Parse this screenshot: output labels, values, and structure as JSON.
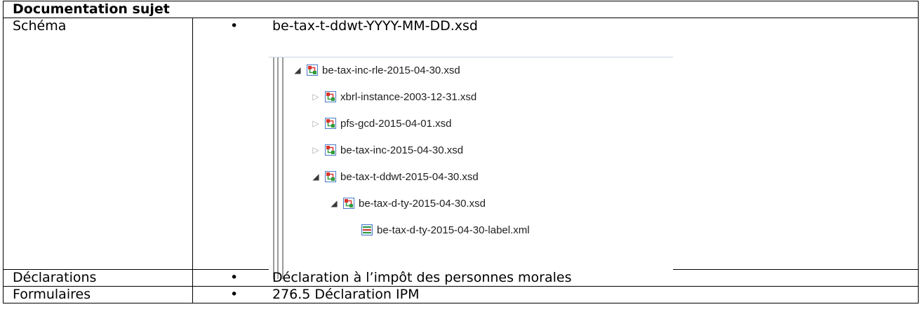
{
  "table": {
    "header": "Documentation sujet",
    "rows": [
      {
        "label": "Schéma",
        "bullets": [
          "be-tax-t-ddwt-YYYY-MM-DD.xsd"
        ]
      },
      {
        "label": "Déclarations",
        "bullets": [
          "Déclaration à l’impôt des personnes morales"
        ]
      },
      {
        "label": "Formulaires",
        "bullets": [
          "276.5 Déclaration IPM"
        ]
      }
    ]
  },
  "tree": {
    "nodes": [
      {
        "label": "be-tax-inc-rle-2015-04-30.xsd",
        "expander": "expanded",
        "icon": "xsd-schema-icon"
      },
      {
        "label": "xbrl-instance-2003-12-31.xsd",
        "expander": "collapsed",
        "icon": "xsd-schema-icon"
      },
      {
        "label": "pfs-gcd-2015-04-01.xsd",
        "expander": "collapsed",
        "icon": "xsd-schema-icon"
      },
      {
        "label": "be-tax-inc-2015-04-30.xsd",
        "expander": "collapsed",
        "icon": "xsd-schema-icon"
      },
      {
        "label": "be-tax-t-ddwt-2015-04-30.xsd",
        "expander": "expanded",
        "icon": "xsd-schema-icon"
      },
      {
        "label": "be-tax-d-ty-2015-04-30.xsd",
        "expander": "expanded",
        "icon": "xsd-schema-icon"
      },
      {
        "label": "be-tax-d-ty-2015-04-30-label.xml",
        "expander": "none",
        "icon": "xml-linkbase-icon"
      }
    ]
  }
}
